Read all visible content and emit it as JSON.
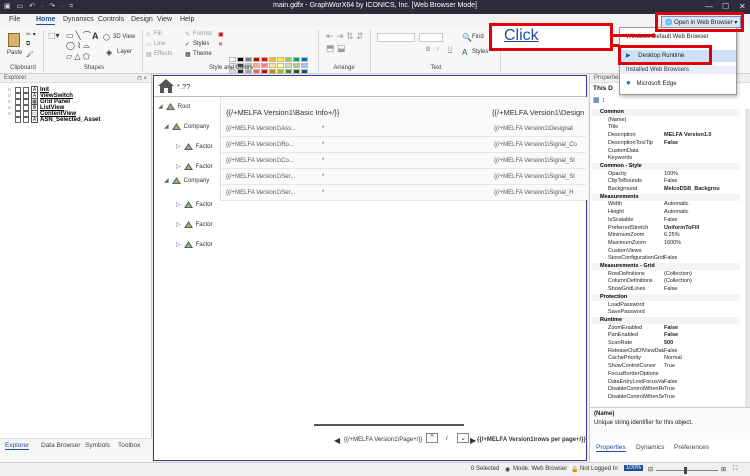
{
  "window": {
    "title": "main.gdfx - GraphWorX64 by ICONICS, Inc. [Web Browser Mode]",
    "quick_access": "▣ ▭ ↶ · ↷ · ="
  },
  "menu": {
    "tabs": [
      "File",
      "Home",
      "Dynamics",
      "Controls",
      "Design",
      "View",
      "Help"
    ],
    "active": "Home"
  },
  "ribbon": {
    "groups": {
      "clipboard": "Clipboard",
      "shapes": "Shapes",
      "style_colors": "Style and Colors",
      "arrange": "Arrange",
      "text": "Text"
    },
    "paste": "Paste",
    "view3d": "3D View",
    "layer": "Layer",
    "fill": "Fill",
    "line": "Line",
    "effects": "Effects",
    "format": "Format",
    "styles": "Styles",
    "theme": "Theme",
    "filters": "Filters",
    "find": "Find",
    "text_styles": "Styles",
    "font_bold": "B",
    "font_italic": "I",
    "font_underline": "U",
    "open_in_browser": "Open in Web Browser"
  },
  "palette": [
    "#ffffff",
    "#000000",
    "#7f7f7f",
    "#c00000",
    "#ff0000",
    "#ffc000",
    "#ffff00",
    "#92d050",
    "#00b050",
    "#0070c0",
    "#f2f2f2",
    "#404040",
    "#bfbfbf",
    "#f4b183",
    "#ff7c80",
    "#ffe699",
    "#ffff99",
    "#c5e0b4",
    "#a9d18e",
    "#9dc3e6",
    "#d9d9d9",
    "#262626",
    "#a6a6a6",
    "#e06666",
    "#cc0000",
    "#bf9000",
    "#b8b800",
    "#548235",
    "#375623",
    "#1f4e79",
    "#bdd7ee",
    "#2e75b6",
    "#7030a0",
    "#b4a7d6",
    "#8e7cc3",
    "#d5a6bd",
    "#a64d79",
    "#76a5af",
    "#45818e",
    "#134f5c"
  ],
  "explorer": {
    "header": "Explorer",
    "pin": "⊓ ×",
    "items": [
      {
        "name": "Init",
        "icon": "A",
        "check": true,
        "underline": true
      },
      {
        "name": "ViewSwitch",
        "icon": "A",
        "check": true,
        "underline": true
      },
      {
        "name": "Grid Panel",
        "icon": "▦",
        "check": true,
        "underline": false
      },
      {
        "name": "ListView",
        "icon": "≣",
        "check": true,
        "underline": true
      },
      {
        "name": "ContentView",
        "icon": "▭",
        "check": true,
        "underline": true
      },
      {
        "name": "ASN_Selected_Asset",
        "icon": "A",
        "check": true,
        "underline": false
      }
    ],
    "bottom_tabs": [
      "Explorer",
      "Data Browser",
      "Symbols",
      "Toolbox"
    ]
  },
  "canvas": {
    "path": "*.??",
    "root": "Root",
    "tree": [
      {
        "label": "Company",
        "level": 1
      },
      {
        "label": "Factor",
        "level": 2
      },
      {
        "label": "Factor",
        "level": 2
      },
      {
        "label": "Company",
        "level": 1
      },
      {
        "label": "Factor",
        "level": 2
      },
      {
        "label": "Factor",
        "level": 2
      },
      {
        "label": "Factor",
        "level": 2
      }
    ],
    "grid": {
      "headers": [
        "{{/+MELFA Version1\\Basic Info+/}}",
        "{{/+MELFA Version1\\Design"
      ],
      "rows": [
        [
          "{{/+MELFA Version1\\Ass...",
          "*",
          "{{/+MELFA Version1\\Designat"
        ],
        [
          "{{/+MELFA Version1\\Ro...",
          "*",
          "{{/+MELFA Version1\\Signal_Co"
        ],
        [
          "{{/+MELFA Version1\\Co...",
          "*",
          "{{/+MELFA Version1\\Signal_St"
        ],
        [
          "{{/+MELFA Version1\\Ser...",
          "*",
          "{{/+MELFA Version1\\Signal_St"
        ],
        [
          "{{/+MELFA Version1\\Ser...",
          "*",
          "{{/+MELFA Version1\\Signal_H"
        ]
      ]
    },
    "pager": {
      "page": "{{/+MELFA Version1\\Page+/}}",
      "slash": "/",
      "rows_per_page": "{{/+MELFA Version1\\rows per page+/}}",
      "up": "^",
      "down": "⌄"
    }
  },
  "properties": {
    "header": "Properties",
    "subtitle": "This D",
    "rows": [
      {
        "cat": "Common"
      },
      {
        "k": "(Name)",
        "v": ""
      },
      {
        "k": "Title",
        "v": ""
      },
      {
        "k": "Description",
        "v": "MELFA Version1.0",
        "b": true
      },
      {
        "k": "DescriptionToolTip",
        "v": "False",
        "b": true
      },
      {
        "k": "CustomData",
        "v": ""
      },
      {
        "k": "Keywords",
        "v": ""
      },
      {
        "cat": "Common - Style"
      },
      {
        "k": "Opacity",
        "v": "100%"
      },
      {
        "k": "ClipToBounds",
        "v": "False"
      },
      {
        "k": "Background",
        "v": "MelcoDSB_Backgrou",
        "b": true
      },
      {
        "cat": "Measurements"
      },
      {
        "k": "Width",
        "v": "Automatic"
      },
      {
        "k": "Height",
        "v": "Automatic"
      },
      {
        "k": "IsScalable",
        "v": "False"
      },
      {
        "k": "PreferredStretch",
        "v": "UniformToFill",
        "b": true
      },
      {
        "k": "MinimumZoom",
        "v": "6.25%"
      },
      {
        "k": "MaximumZoom",
        "v": "1600%"
      },
      {
        "k": "CustomViews",
        "v": ""
      },
      {
        "k": "StoreConfigurationGrid",
        "v": "False"
      },
      {
        "cat": "Measurements - Grid"
      },
      {
        "k": "RowDefinitions",
        "v": "(Collection)"
      },
      {
        "k": "ColumnDefinitions",
        "v": "(Collection)"
      },
      {
        "k": "ShowGridLines",
        "v": "False"
      },
      {
        "cat": "Protection"
      },
      {
        "k": "LoadPassword",
        "v": ""
      },
      {
        "k": "SavePassword",
        "v": ""
      },
      {
        "cat": "Runtime"
      },
      {
        "k": "ZoomEnabled",
        "v": "False",
        "b": true
      },
      {
        "k": "PanEnabled",
        "v": "False",
        "b": true
      },
      {
        "k": "ScanRate",
        "v": "500",
        "b": true
      },
      {
        "k": "ReleaseOutOfViewData",
        "v": "False"
      },
      {
        "k": "CachePriority",
        "v": "Normal"
      },
      {
        "k": "ShowControlCursor",
        "v": "True"
      },
      {
        "k": "FocusBorderOptions",
        "v": ""
      },
      {
        "k": "DataEntryLostFocusVa",
        "v": "False"
      },
      {
        "k": "DisableControlWhenRe",
        "v": "True"
      },
      {
        "k": "DisableControlWhenSe",
        "v": "True"
      }
    ],
    "desc_title": "(Name)",
    "desc_text": "Unique string identifier for this object.",
    "bottom_tabs": [
      "Properties",
      "Dynamics",
      "Preferences"
    ]
  },
  "statusbar": {
    "selected": "0 Selected",
    "mode": "Mode: Web Browser",
    "login": "Not Logged In",
    "zoom": "100%"
  },
  "dropdown": {
    "windows_default": "Windows Default Web Browser",
    "desktop_runtime": "Desktop Runtime",
    "installed_header": "Installed Web Browsers",
    "edge": "Microsoft Edge"
  },
  "annotation": {
    "click": "Click"
  },
  "colors": {
    "accent": "#1f4e9a",
    "highlight": "#e0000a",
    "canvas_border": "#3c3c9a"
  }
}
